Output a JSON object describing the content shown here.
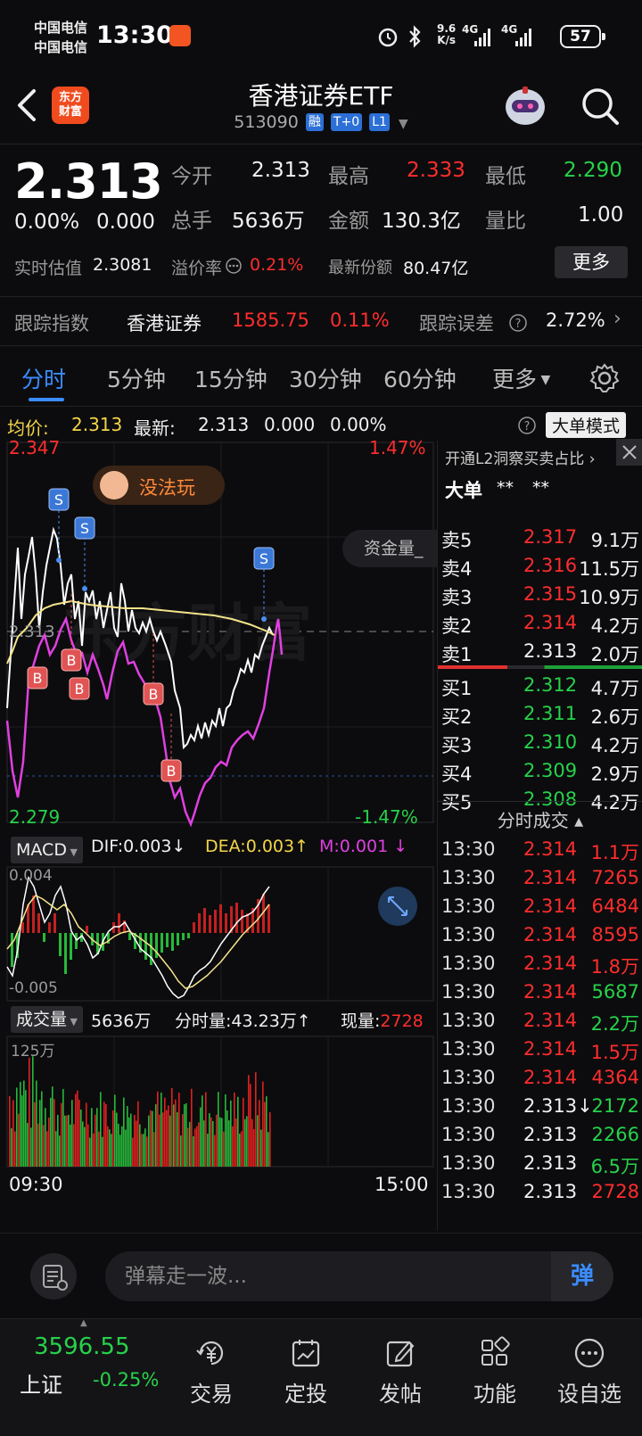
{
  "status_bar": {
    "carrier1": "中国电信",
    "carrier2": "中国电信",
    "time": "13:30",
    "net_speed_top": "9.6",
    "net_speed_bottom": "K/s",
    "signal1": "4G",
    "signal2": "4G",
    "battery": "57"
  },
  "header": {
    "logo_line1": "东方",
    "logo_line2": "财富",
    "title": "香港证券ETF",
    "code": "513090",
    "tags": [
      "融",
      "T+0",
      "L1"
    ]
  },
  "quote": {
    "price": "2.313",
    "change_pct": "0.00%",
    "change": "0.000",
    "open_label": "今开",
    "open": "2.313",
    "high_label": "最高",
    "high": "2.333",
    "low_label": "最低",
    "low": "2.290",
    "volume_label": "总手",
    "volume": "5636万",
    "amount_label": "金额",
    "amount": "130.3亿",
    "ratio_label": "量比",
    "ratio": "1.00",
    "iopv_label": "实时估值",
    "iopv": "2.3081",
    "premium_label": "溢价率",
    "premium": "0.21%",
    "shares_label": "最新份额",
    "shares": "80.47亿",
    "more_label": "更多"
  },
  "tracking": {
    "label": "跟踪指数",
    "index_name": "香港证券",
    "index_value": "1585.75",
    "index_pct": "0.11%",
    "error_label": "跟踪误差",
    "error_value": "2.72%"
  },
  "tabs": [
    "分时",
    "5分钟",
    "15分钟",
    "30分钟",
    "60分钟",
    "更多"
  ],
  "avg_bar": {
    "avg_label": "均价:",
    "avg_value": "2.313",
    "latest_label": "最新:",
    "latest_value": "2.313",
    "latest_change": "0.000",
    "latest_pct": "0.00%",
    "big_order_mode": "大单模式"
  },
  "chart": {
    "y_max": "2.347",
    "y_max_pct": "1.47%",
    "y_min": "2.279",
    "y_min_pct": "-1.47%",
    "y_mid": "2.313",
    "watermark": "东方财富",
    "bubble_text": "没法玩",
    "fund_flow_tab": "资金量_",
    "sell_marker": "S",
    "buy_marker": "B",
    "macd_label": "MACD",
    "dif": "DIF:0.003↓",
    "dea": "DEA:0.003↑",
    "m": "M:0.001 ↓",
    "macd_top": "0.004",
    "macd_bottom": "-0.005",
    "vol_label": "成交量",
    "vol_total": "5636万",
    "vol_minute": "分时量:43.23万↑",
    "vol_now_label": "现量:",
    "vol_now": "2728",
    "vol_max": "125万",
    "time_start": "09:30",
    "time_end": "15:00"
  },
  "order_book": {
    "promo": "开通L2洞察买卖占比 ›",
    "big_label": "大单",
    "big_v1": "**",
    "big_v2": "**",
    "asks": [
      {
        "label": "卖5",
        "price": "2.317",
        "vol": "9.1万"
      },
      {
        "label": "卖4",
        "price": "2.316",
        "vol": "11.5万"
      },
      {
        "label": "卖3",
        "price": "2.315",
        "vol": "10.9万"
      },
      {
        "label": "卖2",
        "price": "2.314",
        "vol": "4.2万"
      },
      {
        "label": "卖1",
        "price": "2.313",
        "vol": "2.0万"
      }
    ],
    "bids": [
      {
        "label": "买1",
        "price": "2.312",
        "vol": "4.7万"
      },
      {
        "label": "买2",
        "price": "2.311",
        "vol": "2.6万"
      },
      {
        "label": "买3",
        "price": "2.310",
        "vol": "4.2万"
      },
      {
        "label": "买4",
        "price": "2.309",
        "vol": "2.9万"
      },
      {
        "label": "买5",
        "price": "2.308",
        "vol": "4.2万"
      }
    ],
    "trades_title": "分时成交 ▴",
    "trades": [
      {
        "time": "13:30",
        "price": "2.314",
        "vol": "1.1万",
        "pc": "red",
        "vc": "red"
      },
      {
        "time": "13:30",
        "price": "2.314",
        "vol": "7265",
        "pc": "red",
        "vc": "red"
      },
      {
        "time": "13:30",
        "price": "2.314",
        "vol": "6484",
        "pc": "red",
        "vc": "red"
      },
      {
        "time": "13:30",
        "price": "2.314",
        "vol": "8595",
        "pc": "red",
        "vc": "red"
      },
      {
        "time": "13:30",
        "price": "2.314",
        "vol": "1.8万",
        "pc": "red",
        "vc": "red"
      },
      {
        "time": "13:30",
        "price": "2.314",
        "vol": "5687",
        "pc": "red",
        "vc": "green"
      },
      {
        "time": "13:30",
        "price": "2.314",
        "vol": "2.2万",
        "pc": "red",
        "vc": "green"
      },
      {
        "time": "13:30",
        "price": "2.314",
        "vol": "1.5万",
        "pc": "red",
        "vc": "red"
      },
      {
        "time": "13:30",
        "price": "2.314",
        "vol": "4364",
        "pc": "red",
        "vc": "red"
      },
      {
        "time": "13:30",
        "price": "2.313↓",
        "vol": "2172",
        "pc": "white",
        "vc": "green"
      },
      {
        "time": "13:30",
        "price": "2.313",
        "vol": "2266",
        "pc": "white",
        "vc": "green"
      },
      {
        "time": "13:30",
        "price": "2.313",
        "vol": "6.5万",
        "pc": "white",
        "vc": "green"
      },
      {
        "time": "13:30",
        "price": "2.313",
        "vol": "2728",
        "pc": "white",
        "vc": "red"
      }
    ]
  },
  "comment": {
    "placeholder": "弹幕走一波...",
    "danmu_btn": "弹"
  },
  "bottom_nav": {
    "index_value": "3596.55",
    "index_name": "上证",
    "index_pct": "-0.25%",
    "items": [
      "交易",
      "定投",
      "发帖",
      "功能",
      "设自选"
    ]
  },
  "colors": {
    "up": "#ff2d2d",
    "down": "#27d24a",
    "accent": "#3b8cff",
    "avg_line": "#f4e48a",
    "price_line": "#ffffff",
    "magenta_line": "#e040e0"
  }
}
